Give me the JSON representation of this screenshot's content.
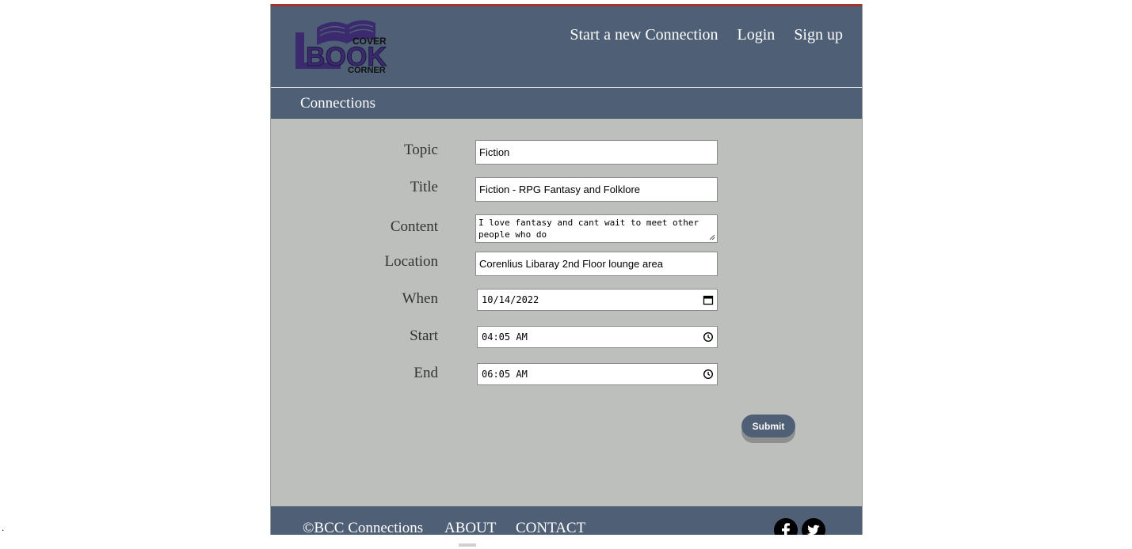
{
  "logo": {
    "lines": [
      "COVER",
      "BOOK",
      "CORNER"
    ]
  },
  "nav": {
    "items": [
      "Start a new Connection",
      "Login",
      "Sign up"
    ]
  },
  "subheader": {
    "title": "Connections"
  },
  "form": {
    "topic": {
      "label": "Topic",
      "value": "Fiction"
    },
    "title": {
      "label": "Title",
      "value": "Fiction - RPG Fantasy and Folklore"
    },
    "content": {
      "label": "Content",
      "value": "I love fantasy and cant wait to meet other people who do"
    },
    "location": {
      "label": "Location",
      "value": "Corenlius Libaray 2nd Floor lounge area"
    },
    "when": {
      "label": "When",
      "value": "10/14/2022"
    },
    "start": {
      "label": "Start",
      "value": "04:05 AM"
    },
    "end": {
      "label": "End",
      "value": "06:05 AM"
    },
    "submit_label": "Submit"
  },
  "footer": {
    "copyright": "©BCC Connections",
    "links": [
      "ABOUT",
      "CONTACT"
    ],
    "social": [
      "facebook-icon",
      "twitter-icon"
    ]
  },
  "colors": {
    "header_bg": "#4f5f76",
    "page_bg": "#bdbfbd",
    "accent_rule": "#a5322b",
    "logo_purple": "#3b2a6e"
  }
}
